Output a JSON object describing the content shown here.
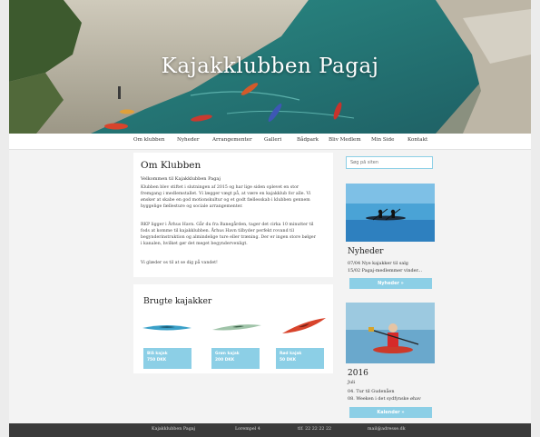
{
  "site": {
    "title": "Kajakklubben Pagaj"
  },
  "nav": {
    "items": [
      "Om klubben",
      "Nyheder",
      "Arrangementer",
      "Galleri",
      "Bådpark",
      "Bliv Medlem",
      "Min Side",
      "Kontakt"
    ]
  },
  "about": {
    "title": "Om Klubben",
    "subtitle": "Velkommen til Kajakklubben Pagaj",
    "paragraphs": [
      "Klubben blev stiftet i slutningen af 2015 og har lige siden oplevet en stor fremgang i medlemstallet. Vi lægger vægt på, at være en kajakklub for alle. Vi ønsker at skabe en god motionskultur og et godt fællesskab i klubben gennem hyggelige fællesture og sociale arrangementer.",
      "RKP ligger i Århus Havn. Går du fra Banegården, tager det cirka 10 minutter til fods at komme til kajakklubben. Århus Havn tilbyder perfekt rovand til begynderinstruktion og almindelige ture eller træning. Der er ingen store bølger i kanalen, hvilket gør det meget begyndervenligt.",
      "Vi glæder os til at se dig på vandet!"
    ]
  },
  "used_kayaks": {
    "title": "Brugte kajakker",
    "items": [
      {
        "name": "Blå kajak",
        "price": "750 DKK",
        "color": "#3aa0c8"
      },
      {
        "name": "Grøn kajak",
        "price": "200 DKK",
        "color": "#6fa585"
      },
      {
        "name": "Rød kajak",
        "price": "50 DKK",
        "color": "#d8442c"
      }
    ]
  },
  "sidebar": {
    "search_placeholder": "Søg på siten",
    "news": {
      "title": "Nyheder",
      "items": [
        "07/04 Nye kajakker til salg",
        "15/02 Pagaj-medlemmer vinder..."
      ],
      "button": "Nyheder »"
    },
    "calendar": {
      "year": "2016",
      "month": "Juli",
      "items": [
        "04. Tur til Gudenåen",
        "08. Weeken i det sydfynske øhav"
      ],
      "button": "Kalender »"
    }
  },
  "footer": {
    "items": [
      "Kajakklubben Pagaj",
      "Lorempel 4",
      "tlf. 22 22 22 22",
      "mail@adresse.dk"
    ]
  },
  "colors": {
    "accent": "#8ccfe6",
    "footer": "#3a3a3a",
    "water": "#2f7f7b"
  }
}
